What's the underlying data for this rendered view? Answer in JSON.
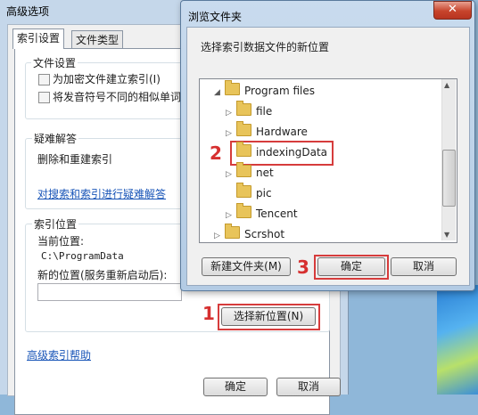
{
  "advanced_dialog": {
    "title": "高级选项",
    "tabs": [
      {
        "label": "索引设置"
      },
      {
        "label": "文件类型"
      }
    ],
    "file_settings": {
      "group_title": "文件设置",
      "checkbox1": "为加密文件建立索引(I)",
      "checkbox2": "将发音符号不同的相似单词"
    },
    "troubleshoot": {
      "group_title": "疑难解答",
      "text": "删除和重建索引",
      "link": "对搜索和索引进行疑难解答"
    },
    "index_location": {
      "group_title": "索引位置",
      "current_label": "当前位置:",
      "current_value": "C:\\ProgramData",
      "new_label": "新的位置(服务重新启动后):",
      "select_button": "选择新位置(N)"
    },
    "help_link": "高级索引帮助",
    "ok_button": "确定",
    "cancel_button": "取消"
  },
  "browse_dialog": {
    "title": "浏览文件夹",
    "close_label": "✕",
    "prompt": "选择索引数据文件的新位置",
    "tree": [
      {
        "label": "Program files",
        "expanded": true
      },
      {
        "label": "file"
      },
      {
        "label": "Hardware"
      },
      {
        "label": "indexingData",
        "selected": true
      },
      {
        "label": "net"
      },
      {
        "label": "pic"
      },
      {
        "label": "Tencent"
      },
      {
        "label": "Scrshot"
      }
    ],
    "new_folder_button": "新建文件夹(M)",
    "ok_button": "确定",
    "cancel_button": "取消"
  },
  "annotations": {
    "step1": "1",
    "step2": "2",
    "step3": "3"
  },
  "colors": {
    "annotation_red": "#d63c3c",
    "link_blue": "#1a56b8"
  }
}
